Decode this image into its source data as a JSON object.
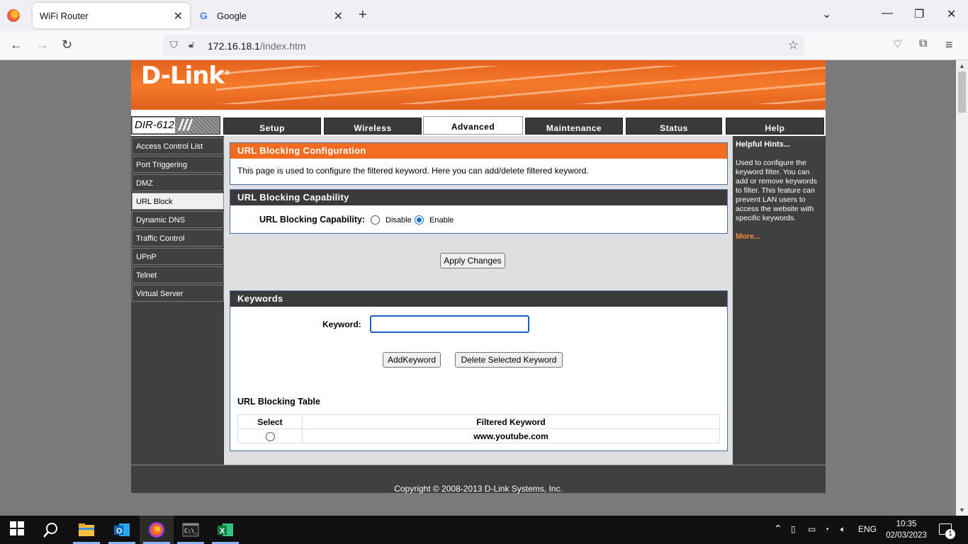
{
  "browser": {
    "tabs": [
      {
        "title": "WiFi Router",
        "active": true
      },
      {
        "title": "Google",
        "active": false
      }
    ],
    "url_host": "172.16.18.1",
    "url_path": "/index.htm"
  },
  "router": {
    "brand": "D-Link",
    "model": "DIR-612",
    "main_tabs": [
      "Setup",
      "Wireless",
      "Advanced",
      "Maintenance",
      "Status",
      "Help"
    ],
    "active_tab": "Advanced",
    "left_nav": [
      "Access Control List",
      "Port Triggering",
      "DMZ",
      "URL Block",
      "Dynamic DNS",
      "Traffic Control",
      "UPnP",
      "Telnet",
      "Virtual Server"
    ],
    "active_nav": "URL Block",
    "config": {
      "title": "URL Blocking Configuration",
      "description": "This page is used to configure the filtered keyword. Here you can add/delete filtered keyword."
    },
    "capability": {
      "title": "URL Blocking Capability",
      "label": "URL Blocking Capability:",
      "options": [
        "Disable",
        "Enable"
      ],
      "selected": "Enable"
    },
    "apply_button": "Apply Changes",
    "keywords": {
      "title": "Keywords",
      "label": "Keyword:",
      "value": "",
      "add_button": "AddKeyword",
      "delete_button": "Delete Selected Keyword"
    },
    "table": {
      "title": "URL Blocking Table",
      "headers": [
        "Select",
        "Filtered Keyword"
      ],
      "rows": [
        {
          "keyword": "www.youtube.com",
          "selected": false
        }
      ]
    },
    "hints": {
      "title": "Helpful Hints...",
      "text": "Used to configure the keyword filter. You can add or remove keywords to filter. This feature can prevent LAN users to access the website with specific keywords.",
      "more": "More..."
    },
    "footer": "Copyright © 2008-2013 D-Link Systems, Inc."
  },
  "taskbar": {
    "language": "ENG",
    "time": "10:35",
    "date": "02/03/2023",
    "notifications": "1"
  }
}
